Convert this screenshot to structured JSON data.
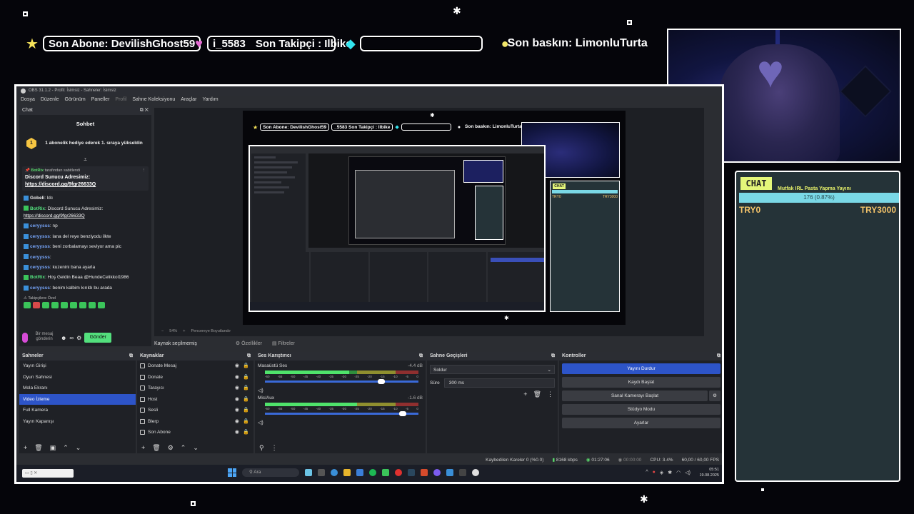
{
  "ticker": {
    "sub_label": "Son Abone: DevilishGhost59",
    "follow_prefix": "i_5583",
    "follow_label": "Son Takipçi : Ilbike",
    "empty_pill": "",
    "raid_label": "Son baskın: LimonluTurta"
  },
  "chat_widget": {
    "title": "CHAT",
    "goal_title": "Mutfak IRL Pasta Yapma Yayını",
    "goal_progress": "176 (0.87%)",
    "goal_fraction": 0.0087,
    "min_label": "TRY0",
    "max_label": "TRY3000"
  },
  "obs": {
    "window_title": "OBS 31.1.2 - Profil: İsimsiz - Sahneler: İsimsiz",
    "menu": [
      "Dosya",
      "Düzenle",
      "Görünüm",
      "Paneller",
      "Profil",
      "Sahne Koleksiyonu",
      "Araçlar",
      "Yardım"
    ],
    "chat_dock": {
      "dock_title": "Chat",
      "header": "Sohbet",
      "gift_text": "1 abonelik hediye ederek 1. sıraya yükseldin",
      "gift_badge": "1",
      "pinned_by": "BotRix",
      "pinned_suffix": "tarafından sabitlendi",
      "pinned_text": "Discord Sunucu Adresimiz:",
      "pinned_link": "https://discord.gg/9fgr26633Q",
      "messages": [
        {
          "user": "Gobeli",
          "text": "ldc",
          "style": "w"
        },
        {
          "user": "BotRix",
          "text": "Discord Sunucu Adresimiz:",
          "link": "https://discord.gg/9fgr26633Q",
          "style": "g"
        },
        {
          "user": "ceryysss",
          "text": "np",
          "style": "b"
        },
        {
          "user": "ceryysss",
          "text": "lana del reye benziyodu ilkte",
          "style": "b"
        },
        {
          "user": "ceryysss",
          "text": "beni zorbalamayı seviyor ama pic",
          "style": "b"
        },
        {
          "user": "ceryysss",
          "text": "",
          "style": "b"
        },
        {
          "user": "ceryysss",
          "text": "kuzenini bana ayarla",
          "style": "b"
        },
        {
          "user": "BotRix",
          "text": "Hoş Geldin Beaa @HundeCelikkol1986",
          "style": "g"
        },
        {
          "user": "ceryysss",
          "text": "benim kalbim kırıldı bu arada",
          "style": "b"
        }
      ],
      "emotes_label": "Takipçilere Özel",
      "input_placeholder": "Bir mesaj gönderin",
      "send_label": "Gönder"
    },
    "preview_footer": [
      "−",
      "54%",
      "+",
      "Pencereye Boyutlandır"
    ],
    "source_bar": {
      "no_selection": "Kaynak seçilmemiş",
      "properties": "Özellikler",
      "filters": "Filtreler"
    },
    "scenes": {
      "title": "Sahneler",
      "items": [
        "Yayın Girişi",
        "Oyun Sahnesi",
        "Mola Ekranı",
        "Video İzleme",
        "Full Kamera",
        "Yayın Kapanışı"
      ],
      "active_index": 3
    },
    "sources": {
      "title": "Kaynaklar",
      "items": [
        "Donate Mesaj",
        "Donate",
        "Tarayıcı",
        "Host",
        "Sesli",
        "Blerp",
        "Son Abone"
      ]
    },
    "mixer": {
      "title": "Ses Karıştırıcı",
      "channels": [
        {
          "name": "Masaüstü Ses",
          "db": "-4.4 dB",
          "level": 0.55,
          "volume": 0.78
        },
        {
          "name": "Mic/Aux",
          "db": "-1.6 dB",
          "level": 0.6,
          "volume": 0.92
        }
      ],
      "scale": [
        "-60",
        "-55",
        "-50",
        "-45",
        "-40",
        "-35",
        "-30",
        "-25",
        "-20",
        "-15",
        "-10",
        "-5",
        "0"
      ]
    },
    "transitions": {
      "title": "Sahne Geçişleri",
      "selected": "Soldur",
      "duration_label": "Süre",
      "duration_value": "300 ms"
    },
    "controls": {
      "title": "Kontroller",
      "buttons": [
        "Yayını Durdur",
        "Kaydı Başlat",
        "Sanal Kamerayı Başlat",
        "Stüdyo Modu",
        "Ayarlar"
      ]
    },
    "status": {
      "dropped": "Kaybedilen Kareler 0 (%0.0)",
      "bitrate": "8168 kbps",
      "stream_time": "01:27:06",
      "rec_time": "00:00:00",
      "cpu": "CPU: 3.4%",
      "fps": "60,00 / 60,00 FPS"
    },
    "taskbar": {
      "search": "Ara",
      "time": "05:51",
      "date": "19.08.2025"
    }
  },
  "preview": {
    "sub_label": "Son Abone: DevilishGhost59",
    "follow_label": "_5583    Son Takipçi : Ilbike",
    "raid_label": "Son baskın: LimonluTurta",
    "chat_title": "CHAT",
    "chat_min": "TRY0",
    "chat_max": "TRY3000"
  },
  "colors": {
    "accent_blue": "#2d54c8",
    "chat_green": "#53e07d",
    "widget_bg": "#253338",
    "goal_bar": "#7ad8e6",
    "chat_title_bg": "#e4f67a"
  }
}
